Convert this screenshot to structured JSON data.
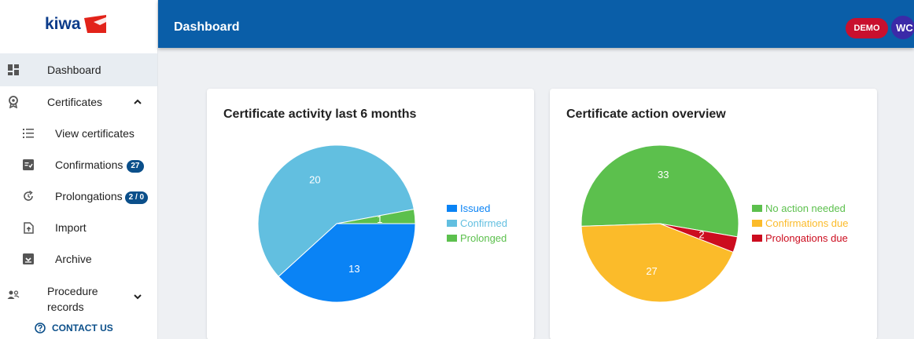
{
  "brand": {
    "logo_text": "kiwa"
  },
  "header": {
    "title": "Dashboard",
    "env_badge": "DEMO",
    "user_initials": "WC"
  },
  "sidebar": {
    "items": [
      {
        "label": "Dashboard"
      },
      {
        "label": "Certificates"
      },
      {
        "label": "View certificates"
      },
      {
        "label": "Confirmations",
        "badge": "27"
      },
      {
        "label": "Prolongations",
        "badge": "2 / 0"
      },
      {
        "label": "Import"
      },
      {
        "label": "Archive"
      },
      {
        "label_line1": "Procedure",
        "label_line2": "records"
      }
    ],
    "contact_label": "CONTACT US"
  },
  "chart_data": [
    {
      "type": "pie",
      "title": "Certificate activity last 6 months",
      "categories": [
        "Issued",
        "Confirmed",
        "Prolonged"
      ],
      "values": [
        13,
        20,
        1
      ],
      "colors": [
        "#0a83f5",
        "#62bfe0",
        "#5cc04d"
      ],
      "labels": [
        "13",
        "20",
        "1"
      ],
      "legend_position": "right"
    },
    {
      "type": "pie",
      "title": "Certificate action overview",
      "categories": [
        "No action needed",
        "Confirmations due",
        "Prolongations due"
      ],
      "values": [
        33,
        27,
        2
      ],
      "colors": [
        "#5cc04d",
        "#fbbb2a",
        "#cc0d1f"
      ],
      "labels": [
        "33",
        "27",
        "2"
      ],
      "legend_position": "right"
    }
  ]
}
